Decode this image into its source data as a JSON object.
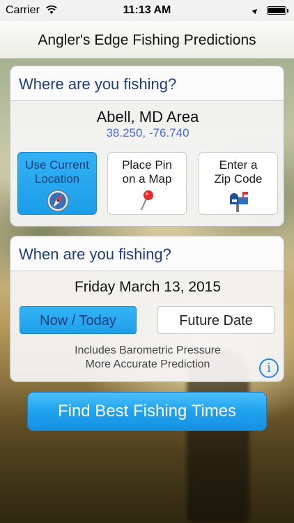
{
  "status_bar": {
    "carrier": "Carrier",
    "time": "11:13 AM"
  },
  "header": {
    "title": "Angler's Edge Fishing Predictions"
  },
  "location_panel": {
    "heading": "Where are you fishing?",
    "location_name": "Abell, MD Area",
    "coordinates": "38.250, -76.740",
    "buttons": [
      {
        "label_line1": "Use Current",
        "label_line2": "Location",
        "icon": "compass-icon",
        "selected": true
      },
      {
        "label_line1": "Place Pin",
        "label_line2": "on a Map",
        "icon": "map-pin-icon",
        "selected": false
      },
      {
        "label_line1": "Enter a",
        "label_line2": "Zip Code",
        "icon": "mailbox-icon",
        "selected": false
      }
    ]
  },
  "date_panel": {
    "heading": "When are you fishing?",
    "date": "Friday March 13, 2015",
    "now_label": "Now / Today",
    "future_label": "Future Date",
    "note_line1": "Includes Barometric Pressure",
    "note_line2": "More Accurate Prediction"
  },
  "action": {
    "find_label": "Find Best Fishing Times"
  },
  "colors": {
    "accent_blue": "#1e9fe9",
    "heading_blue": "#1f3e7c",
    "coords_blue": "#4a6bd6"
  }
}
